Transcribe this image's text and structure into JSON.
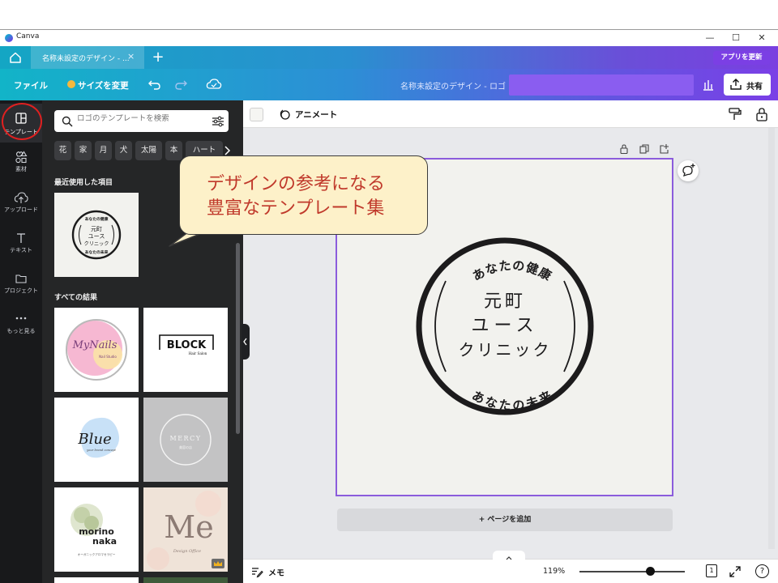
{
  "window": {
    "app_title": "Canva",
    "minimize": "—",
    "maximize": "☐",
    "close": "✕"
  },
  "tabs": {
    "doc_tab": "名称未設定のデザイン - ...",
    "close": "×",
    "new_tab": "+",
    "update_app": "アプリを更新"
  },
  "menubar": {
    "file": "ファイル",
    "resize": "サイズを変更",
    "doc_title": "名称未設定のデザイン - ロゴ",
    "share": "共有"
  },
  "rail": {
    "templates": "テンプレート",
    "elements": "素材",
    "uploads": "アップロード",
    "text": "テキスト",
    "projects": "プロジェクト",
    "more": "もっと見る"
  },
  "panel": {
    "search_placeholder": "ロゴのテンプレートを検索",
    "chips": [
      "花",
      "家",
      "月",
      "犬",
      "太陽",
      "本",
      "ハート"
    ],
    "recent_title": "最近使用した項目",
    "all_results_title": "すべての結果",
    "recent_logo": {
      "top": "あなたの健康",
      "line1": "元町",
      "line2": "ユース",
      "line3": "クリニック",
      "bottom": "あなたの未来"
    },
    "results": [
      {
        "name": "MyNails",
        "sub": "Nail Studio"
      },
      {
        "name": "BLOCK",
        "sub": "Hair Salon"
      },
      {
        "name": "Blue",
        "sub": "your brand concept"
      },
      {
        "name": "MERCY",
        "sub": "美容の店"
      },
      {
        "name": "morino",
        "name2": "naka",
        "sub": "オーガニックアロマセラピー"
      },
      {
        "name": "Me",
        "sub": "Design Office"
      }
    ]
  },
  "toolbar": {
    "animate": "アニメート"
  },
  "canvas": {
    "logo_top": "あなたの健康",
    "logo_line1": "元町",
    "logo_line2": "ユース",
    "logo_line3": "クリニック",
    "logo_bottom": "あなたの未来",
    "add_page": "+ ページを追加"
  },
  "bottom": {
    "memo": "メモ",
    "zoom": "119%",
    "page_count": "1",
    "help": "?"
  },
  "callout": {
    "line1": "デザインの参考になる",
    "line2": "豊富なテンプレート集"
  },
  "colors": {
    "accent_purple": "#7b3fe4",
    "teal": "#12b4c8",
    "callout_text": "#c0392b",
    "highlight_circle": "#e02020"
  }
}
